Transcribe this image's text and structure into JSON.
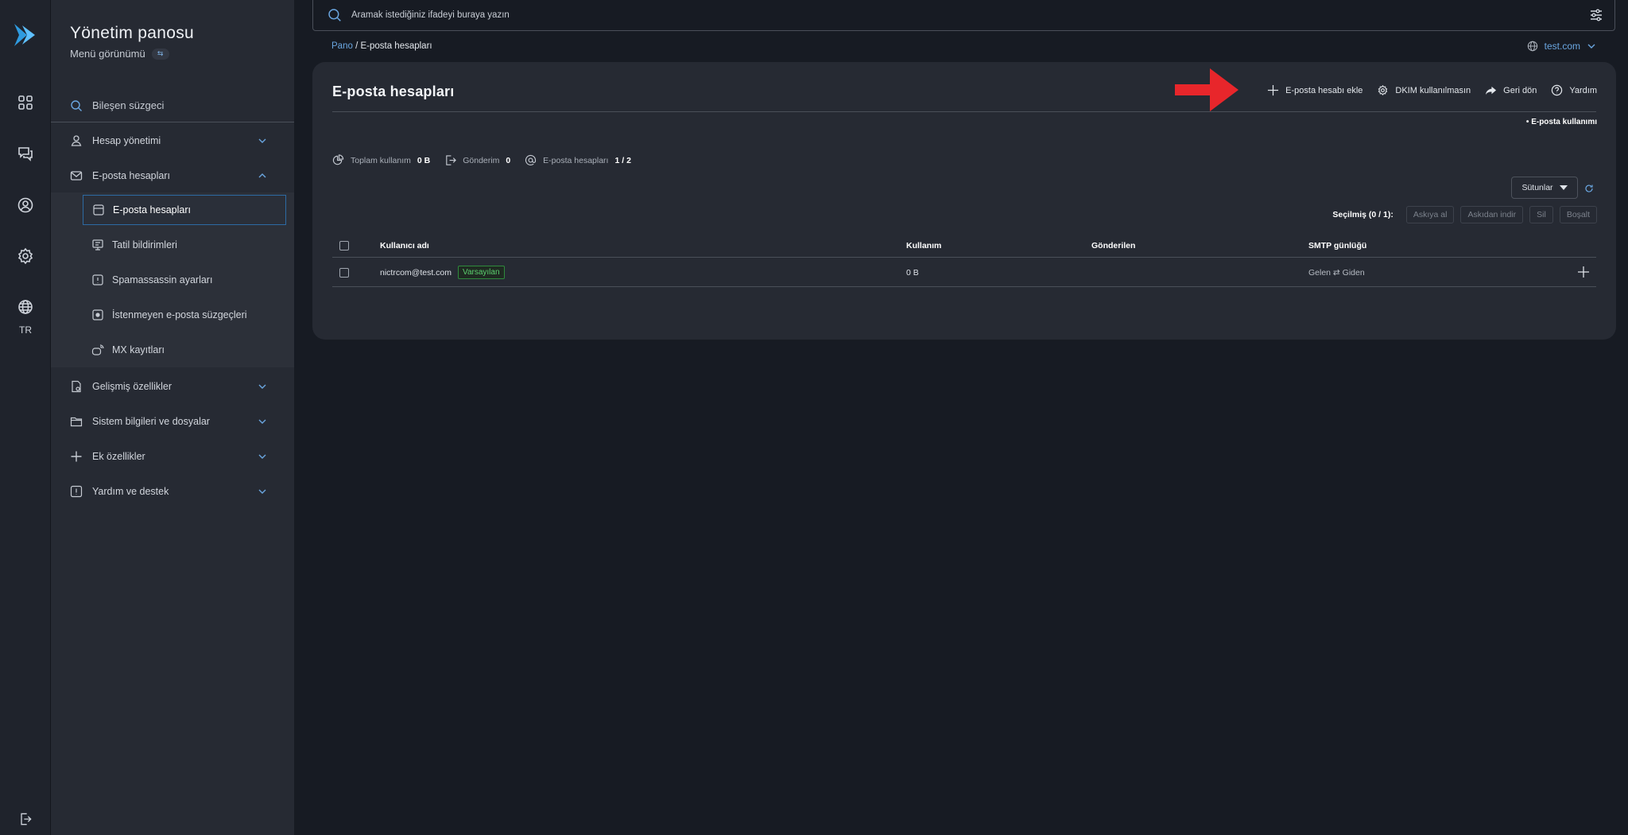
{
  "app": {
    "title": "Yönetim panosu",
    "subtitle": "Menü görünümü",
    "toggle_glyph": "⇆",
    "lang": "TR"
  },
  "rail": {
    "icons": [
      "logo-icon",
      "grid-icon",
      "chat-icon",
      "user-circle-icon",
      "gear-icon",
      "globe-icon",
      "logout-icon"
    ]
  },
  "sidebar": {
    "search_label": "Bileşen süzgeci",
    "items": [
      {
        "label": "Hesap yönetimi",
        "icon": "user-icon",
        "expanded": false
      },
      {
        "label": "E-posta hesapları",
        "icon": "mail-icon",
        "expanded": true
      },
      {
        "label": "Gelişmiş özellikler",
        "icon": "advanced-doc-icon",
        "expanded": false
      },
      {
        "label": "Sistem bilgileri ve dosyalar",
        "icon": "folder-icon",
        "expanded": false
      },
      {
        "label": "Ek özellikler",
        "icon": "plus-icon",
        "expanded": false
      },
      {
        "label": "Yardım ve destek",
        "icon": "alert-icon",
        "expanded": false
      }
    ],
    "subitems": [
      {
        "label": "E-posta hesapları",
        "icon": "mailbox-icon",
        "active": true
      },
      {
        "label": "Tatil bildirimleri",
        "icon": "monitor-icon",
        "active": false
      },
      {
        "label": "Spamassassin ayarları",
        "icon": "warning-box-icon",
        "active": false
      },
      {
        "label": "İstenmeyen e-posta süzgeçleri",
        "icon": "filter-box-icon",
        "active": false
      },
      {
        "label": "MX kayıtları",
        "icon": "mx-icon",
        "active": false
      }
    ]
  },
  "topbar": {
    "search_placeholder": "Aramak istediğiniz ifadeyi buraya yazın"
  },
  "breadcrumb": {
    "root": "Pano",
    "separator": "/",
    "current": "E-posta hesapları"
  },
  "domain_selector": "test.com",
  "page": {
    "title": "E-posta hesapları",
    "actions": {
      "add": "E-posta hesabı ekle",
      "dkim": "DKIM kullanılmasın",
      "back": "Geri dön",
      "help": "Yardım"
    },
    "usage_link": "• E-posta kullanımı"
  },
  "stats": {
    "total_label": "Toplam kullanım",
    "total_value": "0 B",
    "send_label": "Gönderim",
    "send_value": "0",
    "accounts_label": "E-posta hesapları",
    "accounts_value": "1 / 2"
  },
  "table_controls": {
    "columns_label": "Sütunlar",
    "selected_label": "Seçilmiş (0 / 1):",
    "buttons": [
      "Askıya al",
      "Askıdan indir",
      "Sil",
      "Boşalt"
    ]
  },
  "table": {
    "headers": [
      "Kullanıcı adı",
      "Kullanım",
      "Gönderilen",
      "SMTP günlüğü"
    ],
    "rows": [
      {
        "username": "nictrcom@test.com",
        "badge": "Varsayılan",
        "usage": "0 B",
        "sent": "",
        "smtp_log": "Gelen ⇄ Giden"
      }
    ]
  },
  "colors": {
    "accent": "#2f9be0",
    "link": "#6aa6e0",
    "badge_green": "#5bcf6e",
    "arrow_red": "#e8262b",
    "background": "#171b23",
    "card": "#262a33"
  }
}
